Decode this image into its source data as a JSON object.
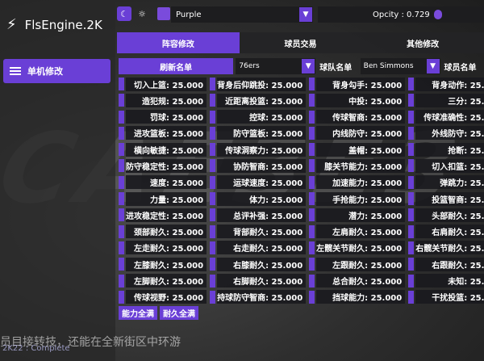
{
  "app": {
    "title": "FlsEngine.2K"
  },
  "sidebar": {
    "items": [
      {
        "label": "单机修改"
      }
    ]
  },
  "topbar": {
    "theme_value": "Purple",
    "opacity_label": "Opcity : 0.729",
    "opacity_value": 0.729
  },
  "tabs": [
    {
      "label": "阵容修改"
    },
    {
      "label": "球员交易"
    },
    {
      "label": "其他修改"
    }
  ],
  "selection": {
    "refresh_label": "刷新名单",
    "team_value": "76ers",
    "team_list_label": "球队名单",
    "player_value": "Ben Simmons",
    "player_list_label": "球员名单"
  },
  "attributes": [
    "切入上篮: 25.000",
    "背身后仰跳投: 25.000",
    "背身勾手: 25.000",
    "背身动作: 25.000",
    "造犯规: 25.000",
    "近距离投篮: 25.000",
    "中投: 25.000",
    "三分: 25.000",
    "罚球: 25.000",
    "控球: 25.000",
    "传球智商: 25.000",
    "传球准确性: 25.000",
    "进攻篮板: 25.000",
    "防守篮板: 25.000",
    "内线防守: 25.000",
    "外线防守: 25.000",
    "横向敏捷: 25.000",
    "传球洞察力: 25.000",
    "盖帽: 25.000",
    "抢断: 25.000",
    "防守稳定性: 25.000",
    "协防智商: 25.000",
    "膝关节能力: 25.000",
    "切入扣篮: 25.000",
    "速度: 25.000",
    "运球速度: 25.000",
    "加速能力: 25.000",
    "弹跳力: 25.000",
    "力量: 25.000",
    "体力: 25.000",
    "手抢能力: 25.000",
    "投篮智商: 25.000",
    "进攻稳定性: 25.000",
    "总评补强: 25.000",
    "潜力: 25.000",
    "头部耐久: 25.000",
    "颈部耐久: 25.000",
    "背部耐久: 25.000",
    "左肩耐久: 25.000",
    "右肩耐久: 25.000",
    "左走耐久: 25.000",
    "右走耐久: 25.000",
    "左髋关节耐久: 25.000",
    "右髋关节耐久: 25.000",
    "左膝耐久: 25.000",
    "右膝耐久: 25.000",
    "左跟耐久: 25.000",
    "右跟耐久: 25.000",
    "左脚耐久: 25.000",
    "右脚耐久: 25.000",
    "总合耐久: 25.000",
    "未知: 25.000",
    "传球视野: 25.000",
    "持球防守智商: 25.000",
    "挡球能力: 25.000",
    "干扰投篮: 25.000"
  ],
  "bottom_buttons": {
    "max_ability": "能力全满",
    "max_durability": "耐久全满"
  },
  "footer": {
    "text": "员目接转技，还能在全新街区中环游",
    "version": "2K22 : Complete"
  }
}
